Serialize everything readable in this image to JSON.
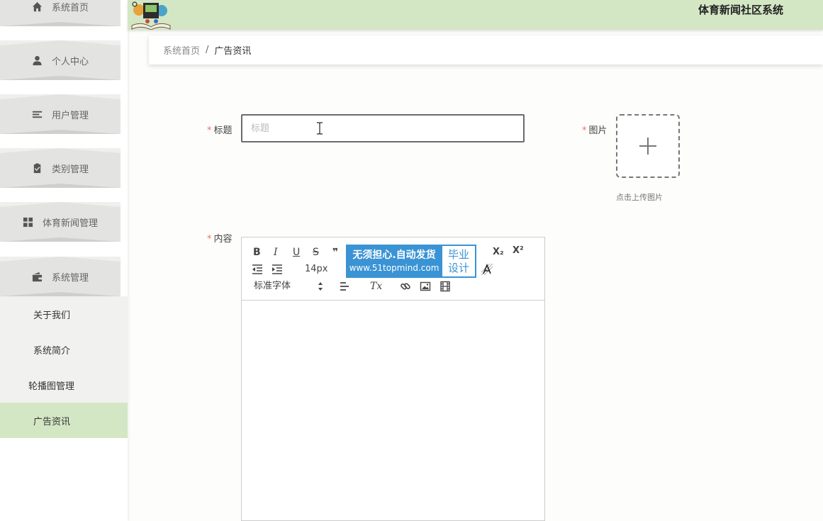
{
  "header": {
    "title": "体育新闻社区系统"
  },
  "sidebar": {
    "items": [
      {
        "label": "系统首页",
        "icon": "home-icon"
      },
      {
        "label": "个人中心",
        "icon": "user-icon"
      },
      {
        "label": "用户管理",
        "icon": "list-icon"
      },
      {
        "label": "类别管理",
        "icon": "clipboard-icon"
      },
      {
        "label": "体育新闻管理",
        "icon": "grid-icon"
      },
      {
        "label": "系统管理",
        "icon": "wallet-icon"
      }
    ],
    "sub_items": [
      {
        "label": "关于我们"
      },
      {
        "label": "系统简介"
      },
      {
        "label": "轮播图管理"
      },
      {
        "label": "广告资讯"
      }
    ]
  },
  "breadcrumb": {
    "home": "系统首页",
    "separator": "/",
    "current": "广告资讯"
  },
  "form": {
    "title_label": "标题",
    "title_placeholder": "标题",
    "image_label": "图片",
    "upload_hint": "点击上传图片",
    "content_label": "内容",
    "required_mark": "*"
  },
  "editor": {
    "bold": "B",
    "italic": "I",
    "underline": "U",
    "strike": "S",
    "subscript": "X₂",
    "superscript": "X²",
    "font_size": "14px",
    "font_family": "标准字体",
    "clear_format": "Tx"
  },
  "promo": {
    "line1": "无须担心.自动发货",
    "line2": "www.51topmind.com",
    "badge1": "毕业",
    "badge2": "设计"
  },
  "colors": {
    "accent": "#d4e7c5",
    "required": "#f56c6c",
    "promo": "#3a93d4"
  }
}
